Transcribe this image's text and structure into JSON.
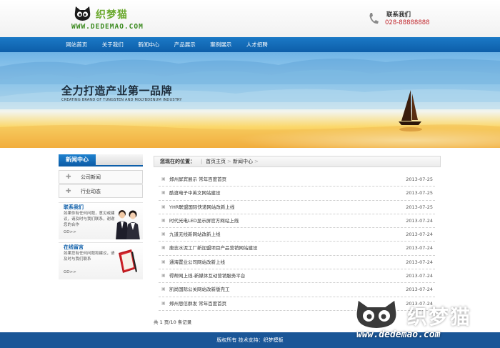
{
  "header": {
    "logo_cn": "织梦猫",
    "logo_url": "WWW.DEDEMAO.COM",
    "contact_title": "联系我们",
    "contact_phone": "028-88888888"
  },
  "nav": {
    "items": [
      "网站首页",
      "关于我们",
      "新闻中心",
      "产品展示",
      "案例展示",
      "人才招聘"
    ]
  },
  "banner": {
    "title": "全力打造产业第一品牌",
    "subtitle": "CREATING BRAND OF TUNGSTEN AND MOLYBDENUM INDUSTRY"
  },
  "sidebar": {
    "heading": "新闻中心",
    "items": [
      "公司新闻",
      "行业动态"
    ],
    "contact_box": {
      "title": "联系我们",
      "text": "如果你有任何问题，意见或建议，请及时与我们联系，谢谢您的合作",
      "more": "GO>>"
    },
    "message_box": {
      "title": "在线留言",
      "text": "如果您有任何问题和建议，请及时与我们联系",
      "more": "GO>>"
    }
  },
  "breadcrumb": {
    "label": "您现在的位置：",
    "items": [
      "首页主页",
      "新闻中心"
    ]
  },
  "news": [
    {
      "title": "郑州屏宾展示 常年百度首页",
      "date": "2013-07-25"
    },
    {
      "title": "酷渡电子中英文网站建设",
      "date": "2013-07-25"
    },
    {
      "title": "YHR联盟国际快递网站改新上线",
      "date": "2013-07-25"
    },
    {
      "title": "时代光电LED显示屏官方网站上线",
      "date": "2013-07-24"
    },
    {
      "title": "九道无线新网站改新上线",
      "date": "2013-07-24"
    },
    {
      "title": "唐志水泥工厂新加盟项目产品营销网站建设",
      "date": "2013-07-24"
    },
    {
      "title": "通海置业公司网站改新上线",
      "date": "2013-07-24"
    },
    {
      "title": "得帮网上线-新媒体互动营销服务平台",
      "date": "2013-07-24"
    },
    {
      "title": "凯尚国际公关网站改新版完工",
      "date": "2013-07-24"
    },
    {
      "title": "郑州思信群发 常年百度首页",
      "date": "2013-07-24"
    }
  ],
  "pager": "共 1 页/10 条记录",
  "footer": "版权所有  技术支持：织梦模板",
  "watermark": {
    "cn": "织梦猫",
    "url": "www.dedemao.com"
  }
}
